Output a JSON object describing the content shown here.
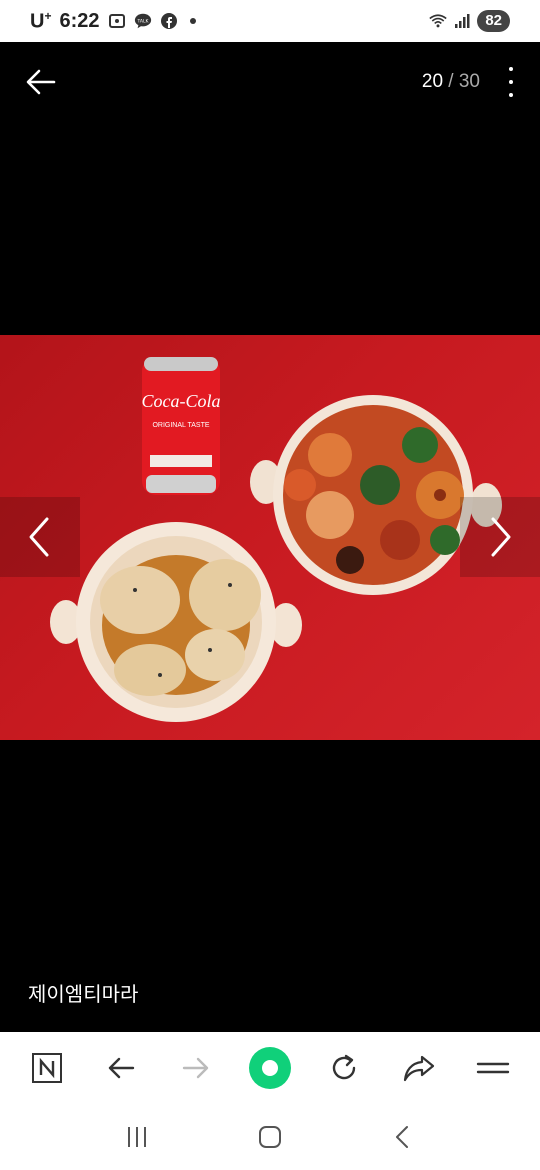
{
  "status_bar": {
    "carrier": "U",
    "carrier_sup": "+",
    "time": "6:22",
    "talk_badge": "TALK",
    "battery": "82"
  },
  "viewer": {
    "current": "20",
    "separator": "/",
    "total": "30"
  },
  "caption": "제이엠티마라",
  "photo": {
    "can_brand": "Coca-Cola",
    "can_sub": "ORIGINAL TASTE"
  },
  "colors": {
    "accent_green": "#10d07a",
    "photo_red": "#c71a20"
  }
}
